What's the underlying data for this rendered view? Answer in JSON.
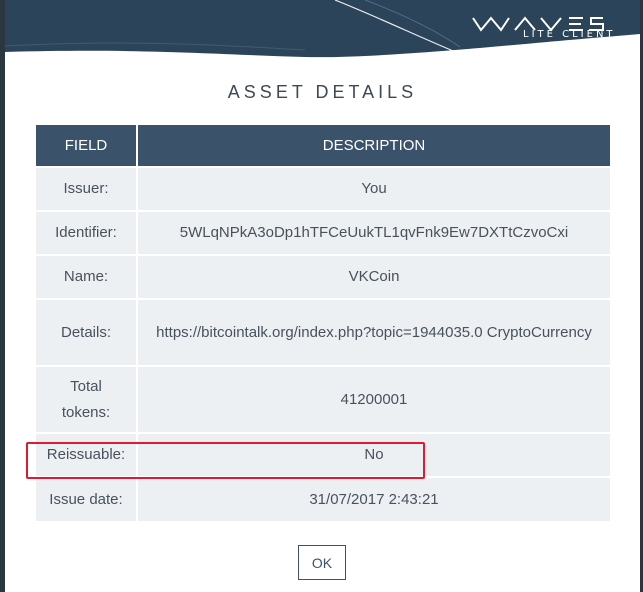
{
  "brand": {
    "logo_text": "WAVES",
    "subtitle": "LITE CLIENT"
  },
  "dialog": {
    "title": "ASSET DETAILS"
  },
  "table": {
    "headers": [
      "FIELD",
      "DESCRIPTION"
    ],
    "rows": [
      {
        "field": "Issuer:",
        "value": "You"
      },
      {
        "field": "Identifier:",
        "value": "5WLqNPkA3oDp1hTFCeUukTL1qvFnk9Ew7DXTtCzvoCxi"
      },
      {
        "field": "Name:",
        "value": "VKCoin"
      },
      {
        "field": "Details:",
        "value": "https://bitcointalk.org/index.php?topic=1944035.0 CryptoCurrency"
      },
      {
        "field": "Total tokens:",
        "value": "41200001"
      },
      {
        "field": "Reissuable:",
        "value": "No"
      },
      {
        "field": "Issue date:",
        "value": "31/07/2017 2:43:21"
      }
    ]
  },
  "highlighted_row": "Reissuable:",
  "buttons": {
    "ok_label": "OK"
  },
  "colors": {
    "header_wave": "#2b4459",
    "table_header": "#3a536a",
    "row_background": "#edf0f2",
    "highlight_border": "#e01a32"
  }
}
